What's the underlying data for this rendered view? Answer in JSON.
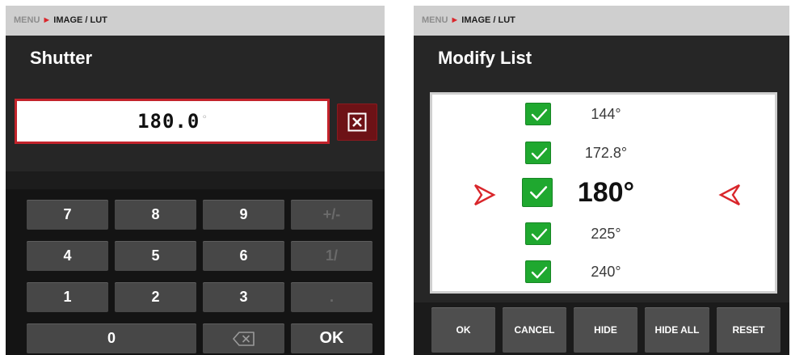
{
  "left_panel": {
    "breadcrumb": {
      "menu": "MENU",
      "separator": "►",
      "current": "IMAGE / LUT"
    },
    "title": "Shutter",
    "value": "180.0",
    "value_unit": "°",
    "clear_icon": "close-box-icon",
    "keypad": {
      "rows": [
        [
          "7",
          "8",
          "9",
          "+/-"
        ],
        [
          "4",
          "5",
          "6",
          "1/"
        ],
        [
          "1",
          "2",
          "3",
          "."
        ]
      ],
      "zero": "0",
      "backspace_icon": "backspace-icon",
      "ok": "OK"
    }
  },
  "right_panel": {
    "breadcrumb": {
      "menu": "MENU",
      "separator": "►",
      "current": "IMAGE / LUT"
    },
    "title": "Modify List",
    "items": [
      {
        "label": "144°",
        "checked": true
      },
      {
        "label": "172.8°",
        "checked": true
      },
      {
        "label": "180°",
        "checked": true,
        "selected": true
      },
      {
        "label": "225°",
        "checked": true
      },
      {
        "label": "240°",
        "checked": true
      }
    ],
    "actions": {
      "ok": "OK",
      "cancel": "CANCEL",
      "hide": "HIDE",
      "hide_all": "HIDE ALL",
      "reset": "RESET"
    }
  },
  "colors": {
    "accent_red": "#c2232b",
    "check_green": "#1fa82f",
    "panel_bg": "#262626",
    "breadcrumb_bg": "#cfcfcf"
  }
}
